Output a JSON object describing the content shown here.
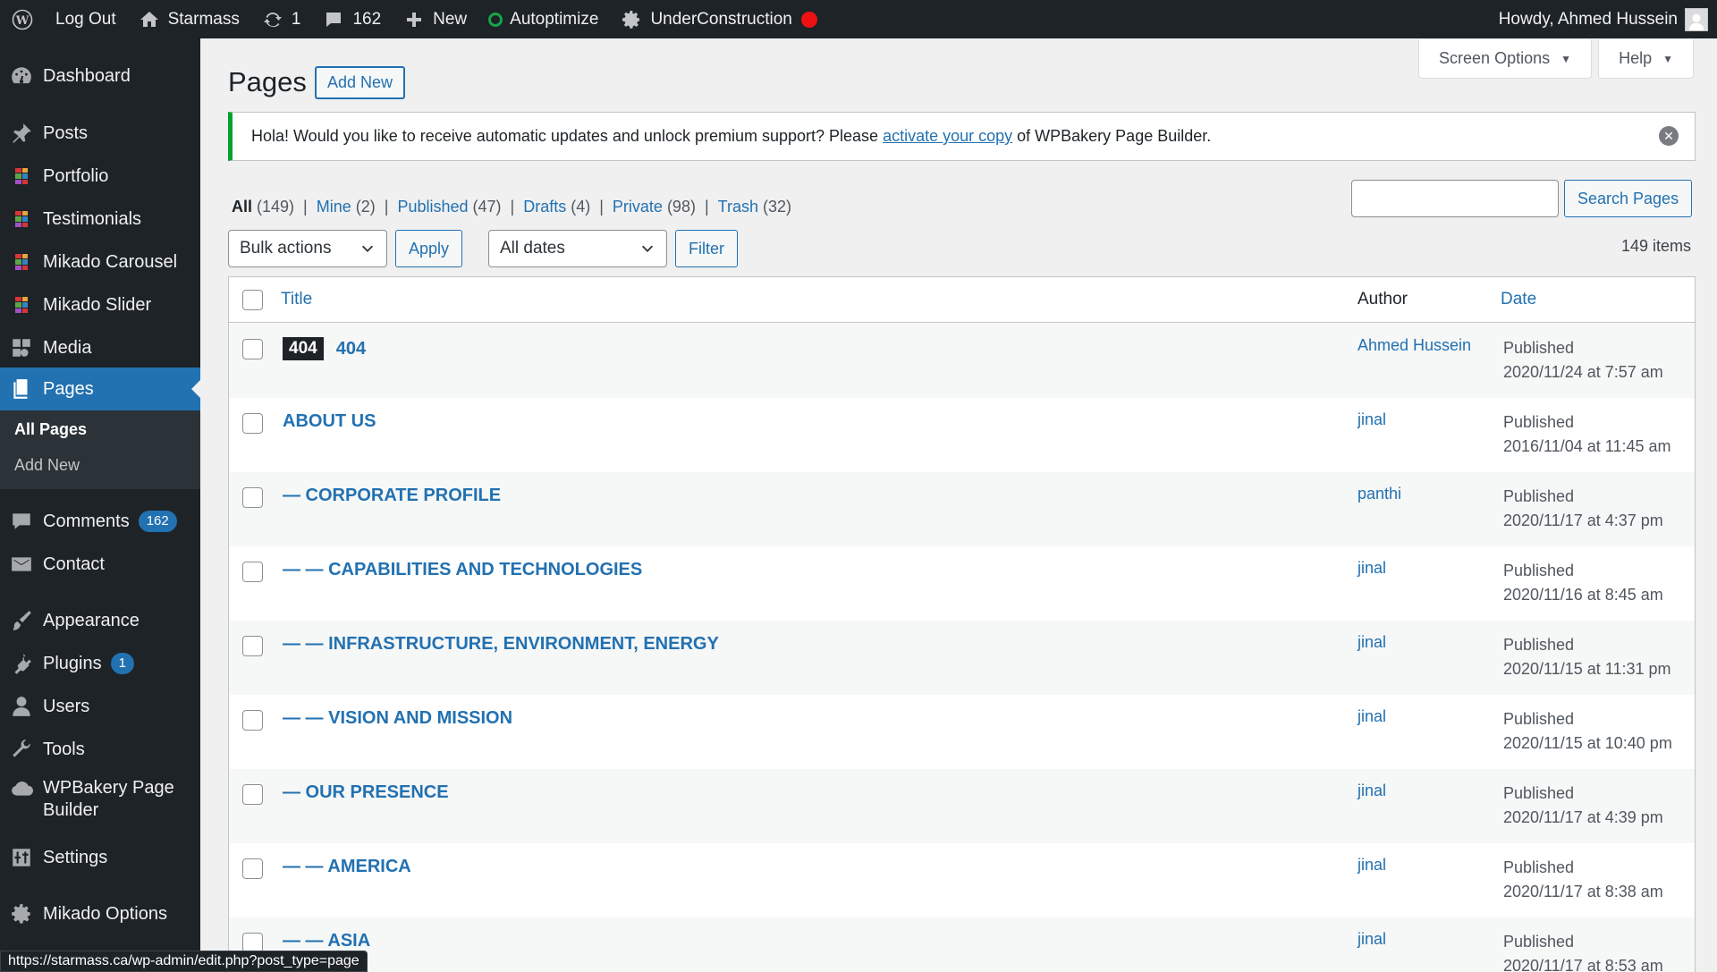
{
  "adminbar": {
    "logout": "Log Out",
    "site": "Starmass",
    "updates": "1",
    "comments": "162",
    "new": "New",
    "autoptimize": "Autoptimize",
    "underconstruction": "UnderConstruction",
    "howdy": "Howdy, Ahmed Hussein"
  },
  "sidebar": {
    "items": [
      {
        "label": "Dashboard",
        "icon": "dashboard-icon"
      },
      {
        "label": "Posts",
        "icon": "pin-icon"
      },
      {
        "label": "Portfolio",
        "icon": "mikado-grid-icon"
      },
      {
        "label": "Testimonials",
        "icon": "mikado-grid-icon"
      },
      {
        "label": "Mikado Carousel",
        "icon": "mikado-grid-icon"
      },
      {
        "label": "Mikado Slider",
        "icon": "mikado-grid-icon"
      },
      {
        "label": "Media",
        "icon": "media-icon"
      },
      {
        "label": "Pages",
        "icon": "pages-icon"
      },
      {
        "label": "Comments",
        "icon": "comment-icon",
        "badge": "162"
      },
      {
        "label": "Contact",
        "icon": "mail-icon"
      },
      {
        "label": "Appearance",
        "icon": "brush-icon"
      },
      {
        "label": "Plugins",
        "icon": "plugin-icon",
        "badge": "1"
      },
      {
        "label": "Users",
        "icon": "user-icon"
      },
      {
        "label": "Tools",
        "icon": "wrench-icon"
      },
      {
        "label": "WPBakery Page Builder",
        "icon": "cloud-icon"
      },
      {
        "label": "Settings",
        "icon": "settings-icon"
      },
      {
        "label": "Mikado Options",
        "icon": "gear-icon"
      }
    ],
    "submenu": [
      "All Pages",
      "Add New"
    ]
  },
  "header": {
    "screen_options": "Screen Options",
    "help": "Help",
    "title": "Pages",
    "add_new": "Add New"
  },
  "notice": {
    "before": "Hola! Would you like to receive automatic updates and unlock premium support? Please",
    "link": "activate your copy",
    "after": "of WPBakery Page Builder."
  },
  "filters": {
    "views": [
      {
        "label": "All",
        "count": "(149)"
      },
      {
        "label": "Mine",
        "count": "(2)"
      },
      {
        "label": "Published",
        "count": "(47)"
      },
      {
        "label": "Drafts",
        "count": "(4)"
      },
      {
        "label": "Private",
        "count": "(98)"
      },
      {
        "label": "Trash",
        "count": "(32)"
      }
    ],
    "search_button": "Search Pages",
    "bulk_actions": "Bulk actions",
    "apply": "Apply",
    "all_dates": "All dates",
    "filter": "Filter",
    "items_count": "149 items"
  },
  "table": {
    "columns": {
      "title": "Title",
      "author": "Author",
      "date": "Date"
    },
    "rows": [
      {
        "tag": "404",
        "title": "404",
        "author": "Ahmed Hussein",
        "status": "Published",
        "date": "2020/11/24 at 7:57 am"
      },
      {
        "title": "ABOUT US",
        "author": "jinal",
        "status": "Published",
        "date": "2016/11/04 at 11:45 am"
      },
      {
        "title": "— CORPORATE PROFILE",
        "author": "panthi",
        "status": "Published",
        "date": "2020/11/17 at 4:37 pm"
      },
      {
        "title": "— — CAPABILITIES AND TECHNOLOGIES",
        "author": "jinal",
        "status": "Published",
        "date": "2020/11/16 at 8:45 am"
      },
      {
        "title": "— — INFRASTRUCTURE, ENVIRONMENT, ENERGY",
        "author": "jinal",
        "status": "Published",
        "date": "2020/11/15 at 11:31 pm"
      },
      {
        "title": "— — VISION AND MISSION",
        "author": "jinal",
        "status": "Published",
        "date": "2020/11/15 at 10:40 pm"
      },
      {
        "title": "— OUR PRESENCE",
        "author": "jinal",
        "status": "Published",
        "date": "2020/11/17 at 4:39 pm"
      },
      {
        "title": "— — AMERICA",
        "author": "jinal",
        "status": "Published",
        "date": "2020/11/17 at 8:38 am"
      },
      {
        "title": "— — ASIA",
        "author": "jinal",
        "status": "Published",
        "date": "2020/11/17 at 8:53 am"
      }
    ]
  },
  "status_url": "https://starmass.ca/wp-admin/edit.php?post_type=page"
}
